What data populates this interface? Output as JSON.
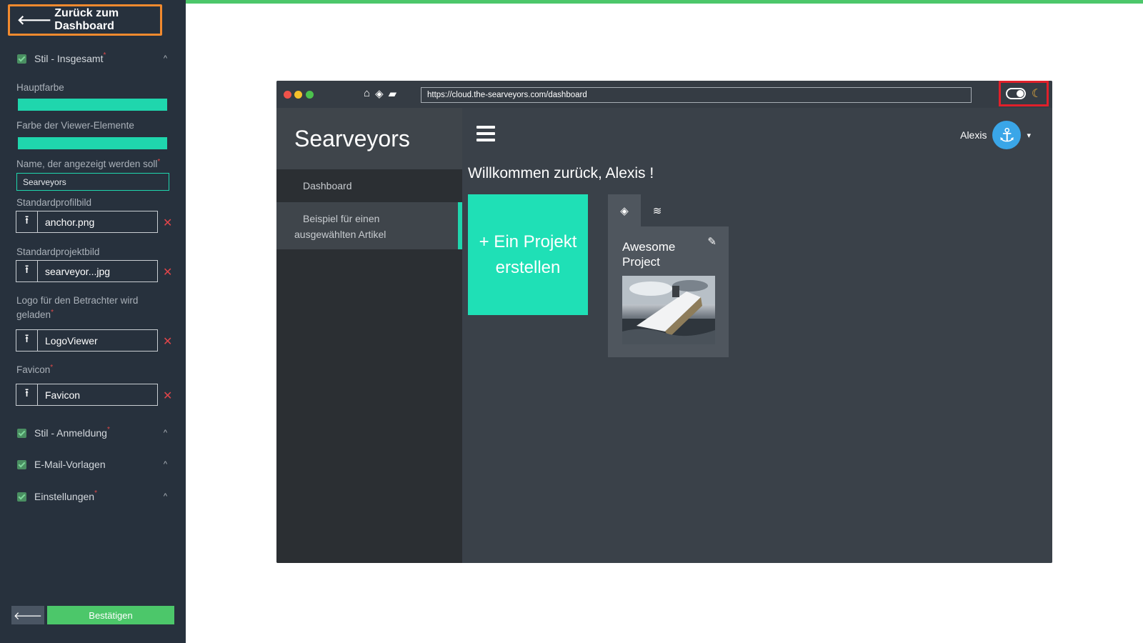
{
  "sidebar": {
    "back_label": "Zurück zum Dashboard",
    "section_style_all": "Stil - Insgesamt",
    "main_color_label": "Hauptfarbe",
    "main_color": "#1fd6ad",
    "viewer_color_label": "Farbe der Viewer-Elemente",
    "viewer_color": "#1fd6ad",
    "display_name_label": "Name, der angezeigt werden soll",
    "display_name_value": "Searveyors",
    "profile_pic_label": "Standardprofilbild",
    "profile_pic_file": "anchor.png",
    "project_pic_label": "Standardprojektbild",
    "project_pic_file": "searveyor...jpg",
    "viewer_logo_label_1": "Logo für den Betrachter wird",
    "viewer_logo_label_2": "geladen",
    "viewer_logo_file": "LogoViewer",
    "favicon_label": "Favicon",
    "favicon_file": "Favicon",
    "section_style_login": "Stil - Anmeldung",
    "section_email": "E-Mail-Vorlagen",
    "section_settings": "Einstellungen",
    "confirm_label": "Bestätigen"
  },
  "preview": {
    "url": "https://cloud.the-searveyors.com/dashboard",
    "brand": "Searveyors",
    "nav_dashboard": "Dashboard",
    "nav_selected_line1": "Beispiel für einen",
    "nav_selected_line2": "ausgewählten Artikel",
    "user_name": "Alexis",
    "welcome": "Willkommen zurück, Alexis !",
    "create_line1": "+ Ein Projekt",
    "create_line2": "erstellen",
    "project_title_line1": "Awesome",
    "project_title_line2": "Project"
  },
  "colors": {
    "accent": "#1fd6ad",
    "highlight_orange": "#f28a2e",
    "highlight_red": "#e0202a",
    "confirm_green": "#4cc76a"
  }
}
